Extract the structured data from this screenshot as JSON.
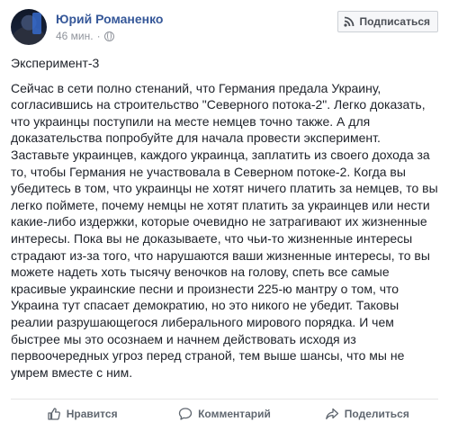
{
  "post": {
    "author": "Юрий Романенко",
    "time": "46 мин.",
    "separator": "·",
    "privacy_icon": "globe-icon",
    "subscribe_label": "Подписаться",
    "subscribe_icon": "rss-icon",
    "title": "Эксперимент-3",
    "body": "Сейчас в сети полно стенаний, что Германия предала Украину,\nсогласившись на строительство \"Северного потока-2\". Легко доказать,\nчто украинцы поступили на месте немцев точно также. А для\nдоказательства попробуйте для начала провести эксперимент.\nЗаставьте украинцев, каждого украинца, заплатить из своего дохода за\nто, чтобы Германия не участвовала в Северном потоке-2. Когда вы\nубедитесь в том, что украинцы не хотят ничего платить за немцев, то вы\nлегко поймете, почему немцы не хотят платить за украинцев или нести\nкакие-либо издержки, которые очевидно не затрагивают их жизненные\nинтересы. Пока вы не доказываете, что чьи-то жизненные интересы\nстрадают из-за того, что нарушаются ваши жизненные интересы, то вы\nможете надеть хоть тысячу веночков на голову, спеть все самые\nкрасивые украинские песни и произнести 225-ю мантру о том, что\nУкраина тут спасает демократию, но это никого не убедит. Таковы\nреалии разрушающегося либерального мирового порядка. И чем\nбыстрее мы это осознаем и начнем действовать исходя из\nпервоочередных угроз перед страной, тем выше шансы, что мы не\nумрем вместе с ним."
  },
  "actions": {
    "like_label": "Нравится",
    "like_icon": "thumbs-up-icon",
    "comment_label": "Комментарий",
    "comment_icon": "comment-icon",
    "share_label": "Поделиться",
    "share_icon": "share-icon"
  },
  "colors": {
    "author_link": "#365899",
    "meta_text": "#90949c",
    "action_text": "#606770",
    "body_text": "#1d2129"
  }
}
